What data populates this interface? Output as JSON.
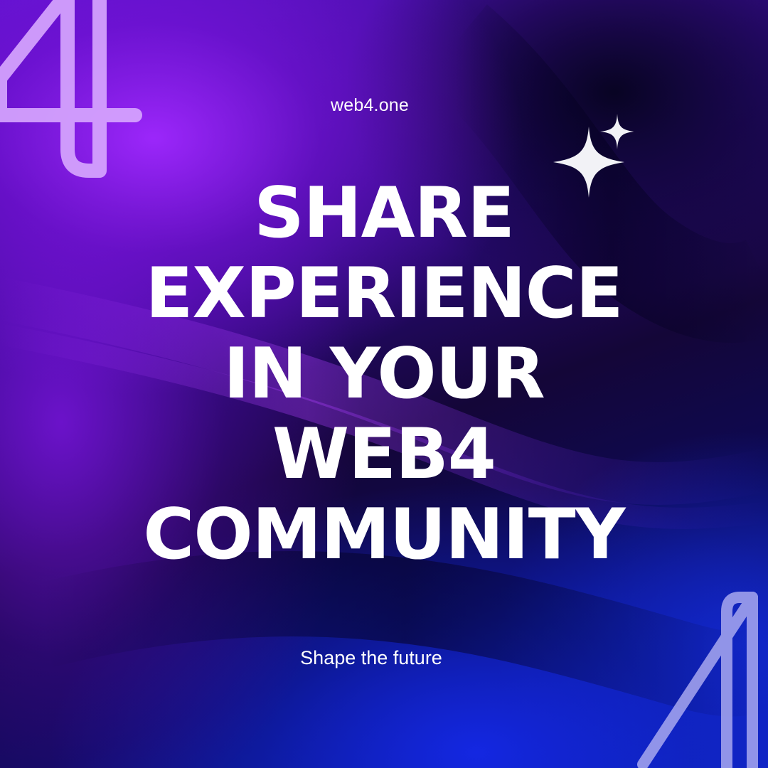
{
  "site": "web4.one",
  "headline": {
    "lines": [
      "SHARE",
      "EXPERIENCE",
      "IN YOUR",
      "WEB4",
      "COMMUNITY"
    ]
  },
  "tagline": "Shape the future",
  "icons": {
    "sparkle": "sparkle-icon",
    "logo": "web4-logo-mark"
  },
  "colors": {
    "text": "#ffffff",
    "purple": "#8a1ef0",
    "deep": "#140638",
    "blue": "#1030d8",
    "logo_top": "#d8a8ff",
    "logo_bottom": "#a8a8f0"
  }
}
